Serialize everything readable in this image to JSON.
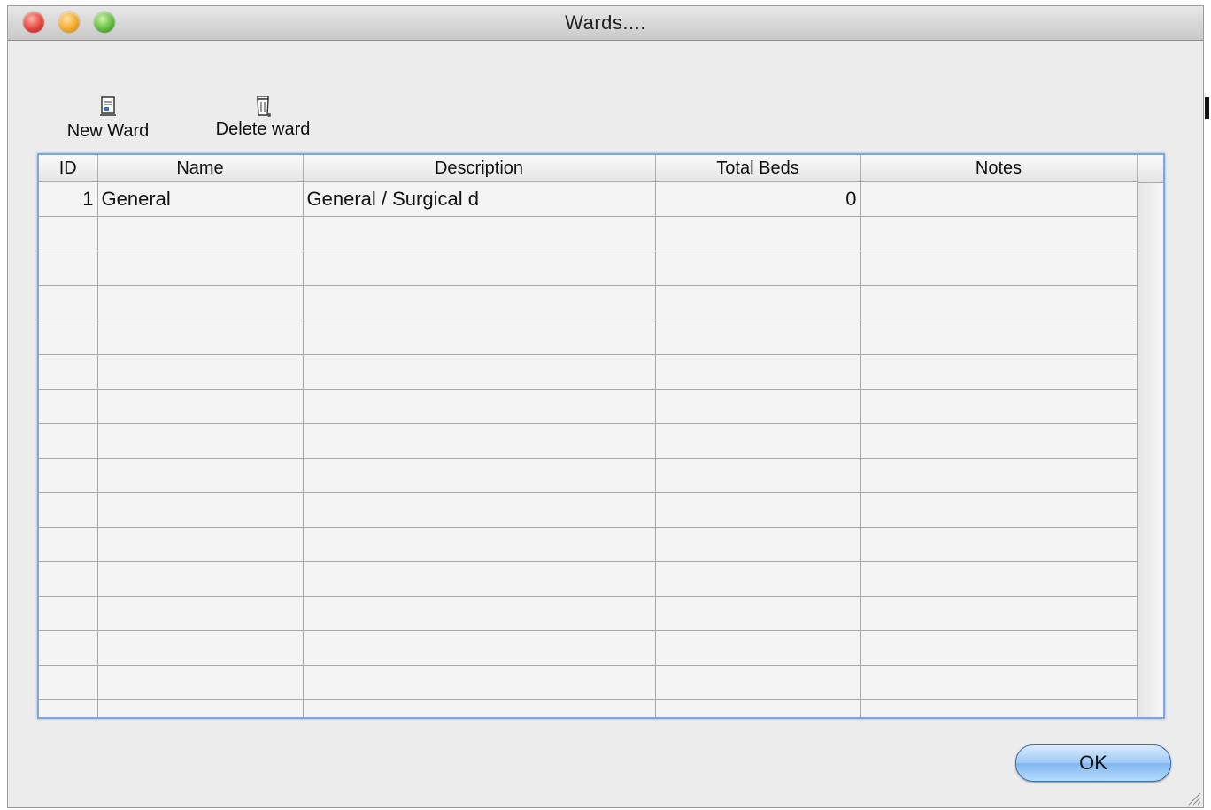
{
  "window": {
    "title": "Wards...."
  },
  "toolbar": {
    "new_ward_label": "New Ward",
    "delete_ward_label": "Delete ward"
  },
  "table": {
    "columns": [
      "ID",
      "Name",
      "Description",
      "Total Beds",
      "Notes"
    ],
    "rows": [
      {
        "id": "1",
        "name": "General",
        "description": "General / Surgical d",
        "total_beds": "0",
        "notes": ""
      }
    ],
    "empty_row_count": 15
  },
  "buttons": {
    "ok_label": "OK"
  },
  "colors": {
    "table_focus_border": "#7fa6d6",
    "ok_button": "#9cc8f5"
  }
}
